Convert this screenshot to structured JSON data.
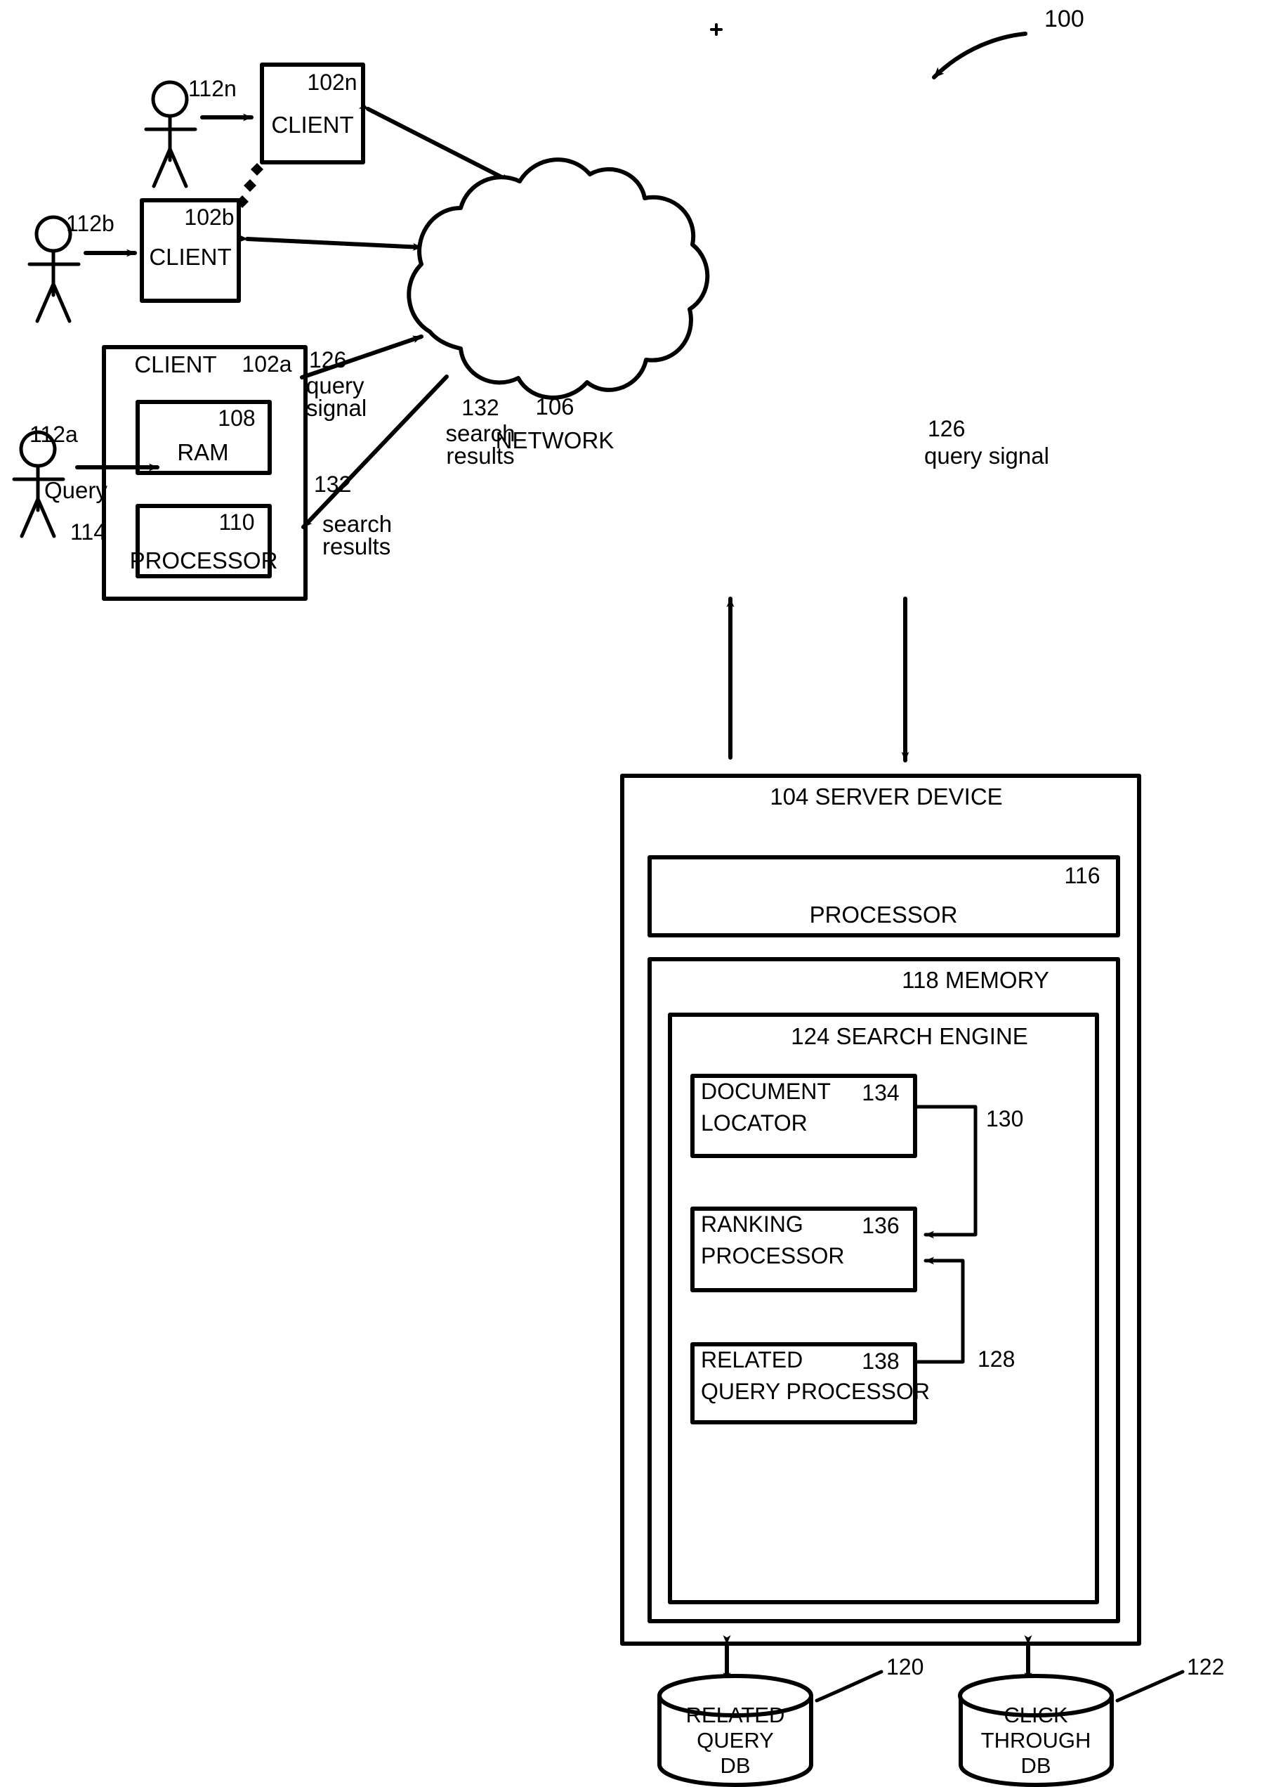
{
  "figure": {
    "number": "100",
    "type": "patent-block-diagram",
    "title_absent": true
  },
  "clients": {
    "client_n": {
      "label": "CLIENT",
      "ref": "102n",
      "user_ref": "112n"
    },
    "client_b": {
      "label": "CLIENT",
      "ref": "102b",
      "user_ref": "112b"
    },
    "client_a": {
      "label": "CLIENT",
      "ref": "102a",
      "user_ref": "112a",
      "query_label": "Query",
      "query_ref": "114",
      "ram": {
        "label": "RAM",
        "ref": "108"
      },
      "processor": {
        "label": "PROCESSOR",
        "ref": "110"
      }
    }
  },
  "network": {
    "ref": "106",
    "label": "NETWORK"
  },
  "signals": {
    "query_signal_left": {
      "ref": "126",
      "line1": "query",
      "line2": "signal"
    },
    "query_signal_right": {
      "ref": "126",
      "text": "query signal"
    },
    "search_results_up": {
      "ref": "132",
      "line1": "search",
      "line2": "results"
    },
    "search_results_left": {
      "ref": "132",
      "line1": "search",
      "line2": "results"
    }
  },
  "server": {
    "header": "104 SERVER DEVICE",
    "processor": {
      "label": "PROCESSOR",
      "ref": "116"
    },
    "memory": {
      "header": "118 MEMORY"
    },
    "search_engine": {
      "header": "124 SEARCH ENGINE",
      "modules": [
        {
          "line1": "DOCUMENT",
          "line2": "LOCATOR",
          "ref": "134"
        },
        {
          "line1": "RANKING",
          "line2": "PROCESSOR",
          "ref": "136"
        },
        {
          "line1": "RELATED",
          "line2": "QUERY PROCESSOR",
          "ref": "138"
        }
      ],
      "bus_refs": {
        "upper": "130",
        "lower": "128"
      }
    }
  },
  "databases": [
    {
      "line1": "RELATED",
      "line2": "QUERY",
      "line3": "DB",
      "ref": "120"
    },
    {
      "line1": "CLICK",
      "line2": "THROUGH",
      "line3": "DB",
      "ref": "122"
    }
  ],
  "icons": {
    "user_stick_figure": "user-icon",
    "cloud": "network-cloud-icon",
    "cylinder": "database-cylinder-icon"
  },
  "colors": {
    "ink": "#000000",
    "paper": "#ffffff"
  }
}
